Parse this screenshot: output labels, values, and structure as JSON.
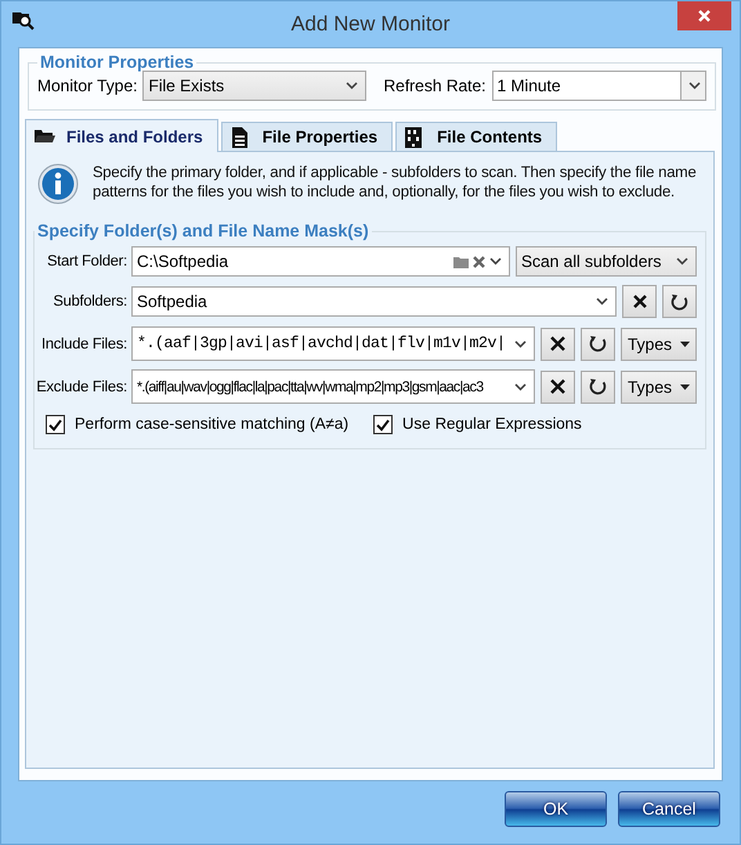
{
  "window": {
    "title": "Add New Monitor"
  },
  "monitor_properties": {
    "title": "Monitor Properties",
    "monitor_type": {
      "label": "Monitor Type:",
      "value": "File Exists"
    },
    "refresh_rate": {
      "label": "Refresh Rate:",
      "value": "1 Minute"
    }
  },
  "tabs": [
    {
      "label": "Files and Folders",
      "selected": true,
      "kind": "folder"
    },
    {
      "label": "File Properties",
      "selected": false,
      "kind": "document"
    },
    {
      "label": "File Contents",
      "selected": false,
      "kind": "binary"
    }
  ],
  "info_text": "Specify the primary folder, and if applicable - subfolders to scan. Then specify the file name patterns for the files you wish to include and, optionally, for the files you wish to exclude.",
  "mask_group": {
    "title": "Specify Folder(s) and File Name Mask(s)",
    "start_folder": {
      "label": "Start Folder:",
      "value": "C:\\Softpedia",
      "scan_mode": "Scan all subfolders"
    },
    "subfolders": {
      "label": "Subfolders:",
      "value": "Softpedia"
    },
    "include_files": {
      "label": "Include Files:",
      "value": "*.(aaf|3gp|avi|asf|avchd|dat|flv|m1v|m2v|",
      "types_button": "Types"
    },
    "exclude_files": {
      "label": "Exclude Files:",
      "value": "*.(aiff|au|wav|ogg|flac|la|pac|tta|wv|wma|mp2|mp3|gsm|aac|ac3",
      "types_button": "Types"
    },
    "options": [
      {
        "label": "Perform case-sensitive matching (A≠a)",
        "checked": true
      },
      {
        "label": "Use Regular Expressions",
        "checked": true
      }
    ]
  },
  "buttons": [
    {
      "label": "OK"
    },
    {
      "label": "Cancel"
    }
  ]
}
